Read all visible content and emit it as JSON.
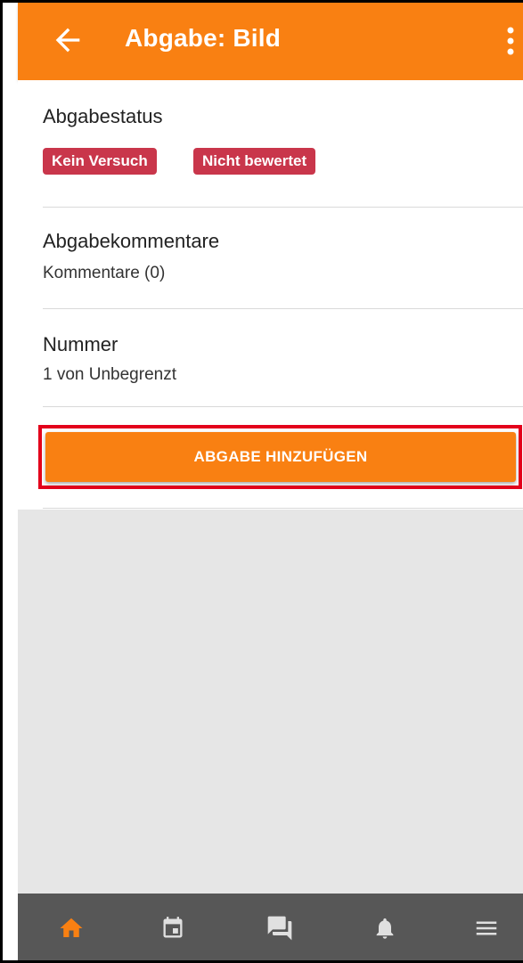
{
  "appbar": {
    "title": "Abgabe: Bild",
    "back_icon": "arrow-left-icon",
    "menu_icon": "more-vert-icon",
    "color": "#f98012"
  },
  "status": {
    "title": "Abgabestatus",
    "badges": [
      "Kein Versuch",
      "Nicht bewertet"
    ],
    "badge_color": "#c9364b"
  },
  "comments": {
    "title": "Abgabekommentare",
    "value": "Kommentare (0)"
  },
  "number": {
    "title": "Nummer",
    "value": "1 von Unbegrenzt"
  },
  "actions": {
    "add_submission": "ABGABE HINZUFÜGEN",
    "highlight_color": "#e3001b"
  },
  "bottom_nav": {
    "items": [
      {
        "icon": "home-icon",
        "active": true
      },
      {
        "icon": "calendar-icon",
        "active": false
      },
      {
        "icon": "messages-icon",
        "active": false
      },
      {
        "icon": "bell-icon",
        "active": false
      },
      {
        "icon": "menu-icon",
        "active": false
      }
    ],
    "active_color": "#f98012"
  }
}
